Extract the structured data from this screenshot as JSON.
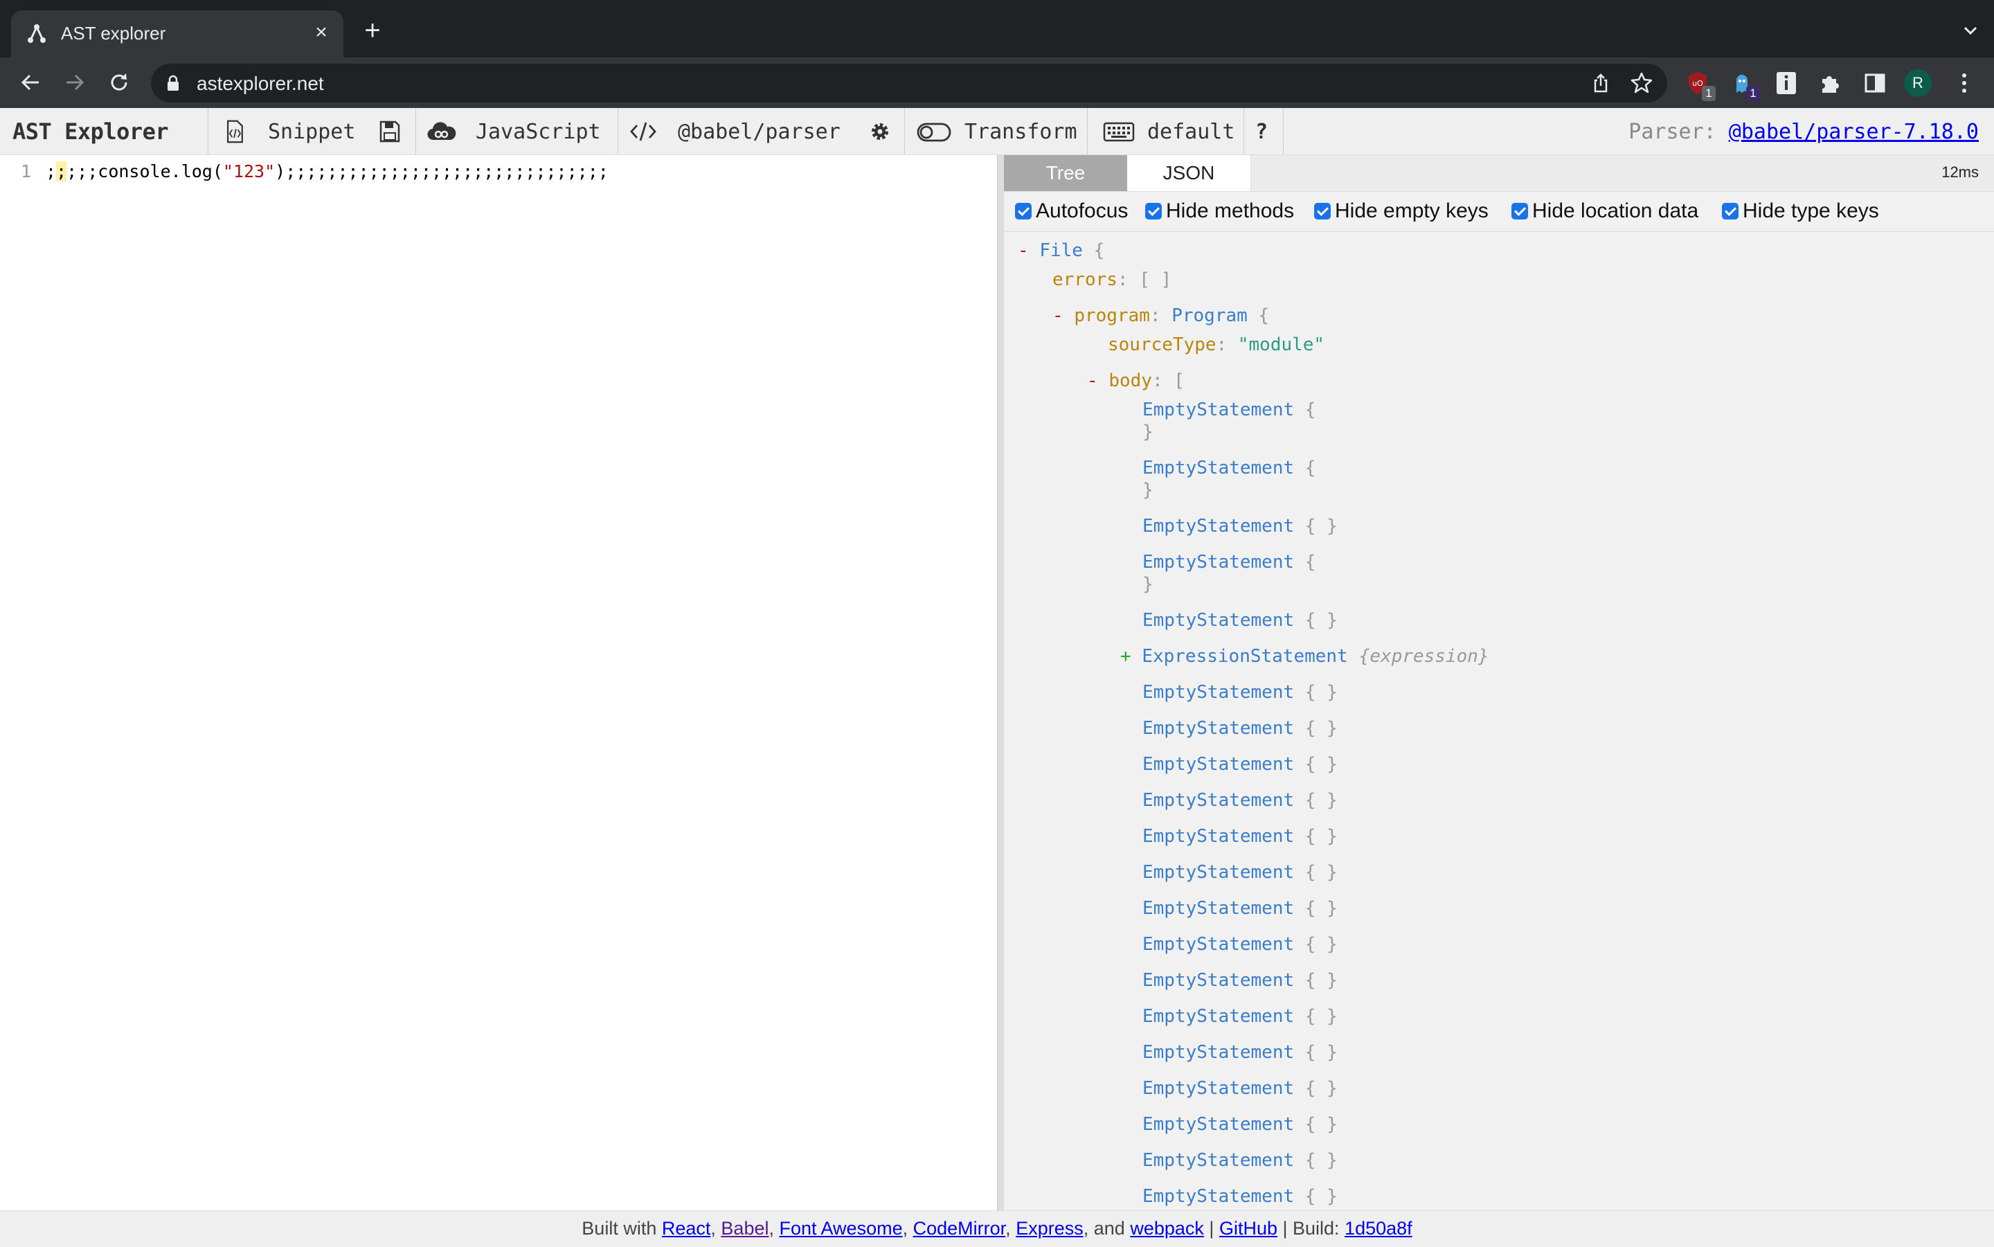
{
  "browser": {
    "tab_title": "AST explorer",
    "url": "astexplorer.net",
    "extension_badges": [
      "1",
      "1"
    ],
    "avatar_initial": "R",
    "icons": [
      "favicon-icon",
      "close-icon",
      "plus-icon",
      "chevron-down-icon",
      "back-icon",
      "forward-icon",
      "reload-icon",
      "lock-icon",
      "share-icon",
      "star-icon",
      "ublock-icon",
      "extension-icon",
      "info-icon",
      "puzzle-icon",
      "sidepanel-icon",
      "kebab-menu-icon"
    ]
  },
  "app_toolbar": {
    "brand": "AST Explorer",
    "snippet": "Snippet",
    "language": "JavaScript",
    "parser": "@babel/parser",
    "transform": "Transform",
    "keymap": "default",
    "help": "?",
    "parser_label": "Parser:",
    "parser_version": "@babel/parser-7.18.0"
  },
  "editor": {
    "line_number": "1",
    "code_prefix_hl": ";",
    "code_prefix2": ";",
    "code_prefix": ";;;console.log(",
    "code_string": "\"123\"",
    "code_suffix": ");;;;;;;;;;;;;;;;;;;;;;;;;;;;;;;"
  },
  "output": {
    "tabs": [
      "Tree",
      "JSON"
    ],
    "timing": "12ms",
    "options": [
      "Autofocus",
      "Hide methods",
      "Hide empty keys",
      "Hide location data",
      "Hide type keys"
    ],
    "tree": {
      "file_type": "File",
      "errors_key": "errors",
      "errors_value": "[ ]",
      "program_key": "program",
      "program_type": "Program",
      "source_type_key": "sourceType",
      "source_type_value": "\"module\"",
      "body_key": "body",
      "body_items": [
        {
          "type": "EmptyStatement",
          "expanded": true
        },
        {
          "type": "EmptyStatement",
          "expanded": true
        },
        {
          "type": "EmptyStatement",
          "expanded": false
        },
        {
          "type": "EmptyStatement",
          "expanded": true
        },
        {
          "type": "EmptyStatement",
          "expanded": false
        },
        {
          "type": "ExpressionStatement",
          "summary": "{expression}"
        },
        {
          "type": "EmptyStatement"
        },
        {
          "type": "EmptyStatement"
        },
        {
          "type": "EmptyStatement"
        },
        {
          "type": "EmptyStatement"
        },
        {
          "type": "EmptyStatement"
        },
        {
          "type": "EmptyStatement"
        },
        {
          "type": "EmptyStatement"
        },
        {
          "type": "EmptyStatement"
        },
        {
          "type": "EmptyStatement"
        },
        {
          "type": "EmptyStatement"
        },
        {
          "type": "EmptyStatement"
        },
        {
          "type": "EmptyStatement"
        },
        {
          "type": "EmptyStatement"
        },
        {
          "type": "EmptyStatement"
        },
        {
          "type": "EmptyStatement"
        }
      ]
    }
  },
  "footer": {
    "built_with": "Built with",
    "links": [
      "React",
      "Babel",
      "Font Awesome",
      "CodeMirror",
      "Express",
      "webpack"
    ],
    "and": "and",
    "github": "GitHub",
    "build_label": "Build:",
    "build_hash": "1d50a8f"
  }
}
